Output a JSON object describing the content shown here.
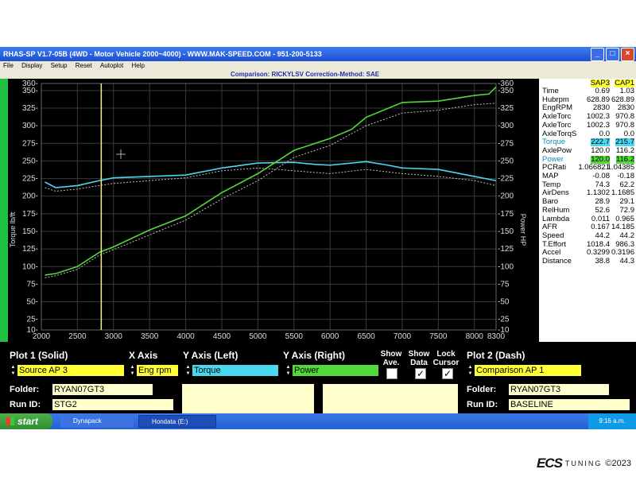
{
  "window": {
    "title": "RHAS-SP V1.7-05B  (4WD - Motor Vehicle 2000~4000) - WWW.MAK-SPEED.COM - 951-200-5133",
    "menu": [
      "File",
      "Display",
      "Setup",
      "Reset",
      "Autoplot",
      "Help"
    ],
    "comparison": "Comparison: RICKYLSV    Correction-Method: SAE"
  },
  "plot": {
    "y_left_label": "Torque lb/ft",
    "y_right_label": "Power HP",
    "cursor_rpm": 2830,
    "colors": {
      "solid_torque": "#4ad8f0",
      "solid_power": "#52d83a",
      "dash": "#c0c0c0",
      "cursor": "#f5f08a",
      "grid": "#3a3a3a"
    }
  },
  "chart_data": {
    "type": "line",
    "x_ticks": [
      2000,
      2500,
      3000,
      3500,
      4000,
      4500,
      5000,
      5500,
      6000,
      6500,
      7000,
      7500,
      8000,
      8300
    ],
    "y_ticks": [
      10,
      25,
      50,
      75,
      100,
      125,
      150,
      175,
      200,
      225,
      250,
      275,
      300,
      325,
      350,
      360
    ],
    "xlim": [
      2000,
      8300
    ],
    "ylim": [
      10,
      360
    ],
    "ylabel": "Torque lb/ft",
    "y2label": "Power HP",
    "series": [
      {
        "name": "Torque",
        "x": [
          2050,
          2200,
          2500,
          2800,
          3000,
          3500,
          4000,
          4500,
          5000,
          5500,
          5800,
          6000,
          6500,
          6800,
          7000,
          7500,
          8000,
          8300
        ],
        "values": [
          220,
          212,
          215,
          222,
          226,
          228,
          230,
          240,
          247,
          248,
          245,
          244,
          249,
          244,
          240,
          238,
          228,
          222
        ]
      },
      {
        "name": "Power",
        "x": [
          2050,
          2200,
          2500,
          2800,
          3000,
          3500,
          4000,
          4500,
          5000,
          5500,
          6000,
          6300,
          6500,
          7000,
          7500,
          8000,
          8200,
          8300
        ],
        "values": [
          88,
          90,
          100,
          120,
          128,
          152,
          172,
          205,
          232,
          265,
          282,
          295,
          312,
          333,
          335,
          343,
          345,
          355
        ]
      },
      {
        "x": [
          2050,
          2200,
          2500,
          2800,
          3000,
          3500,
          4000,
          4500,
          5000,
          5500,
          6000,
          6500,
          7000,
          7500,
          8000,
          8300
        ],
        "values": [
          212,
          207,
          210,
          215,
          218,
          222,
          226,
          236,
          240,
          236,
          232,
          238,
          232,
          228,
          222,
          215
        ]
      },
      {
        "x": [
          2050,
          2200,
          2500,
          2800,
          3000,
          3500,
          4000,
          4500,
          5000,
          5500,
          6000,
          6500,
          7000,
          7500,
          8000,
          8300
        ],
        "values": [
          84,
          87,
          96,
          116,
          124,
          145,
          166,
          196,
          222,
          255,
          272,
          300,
          318,
          322,
          330,
          332
        ]
      }
    ]
  },
  "readout": {
    "headers": [
      "SAP3",
      "CAP1"
    ],
    "rows": [
      {
        "label": "Time",
        "v1": "0.69",
        "v2": "1.03",
        "hl": ""
      },
      {
        "label": "Hubrpm",
        "v1": "628.89",
        "v2": "628.89",
        "hl": ""
      },
      {
        "label": "EngRPM",
        "v1": "2830",
        "v2": "2830",
        "hl": ""
      },
      {
        "label": "AxleTorc",
        "v1": "1002.3",
        "v2": "970.8",
        "hl": ""
      },
      {
        "label": "AxleTorc",
        "v1": "1002.3",
        "v2": "970.8",
        "hl": ""
      },
      {
        "label": "AxleTorqS",
        "v1": "0.0",
        "v2": "0.0",
        "hl": ""
      },
      {
        "label": "Torque",
        "v1": "222.7",
        "v2": "215.7",
        "hl": "#4ad8f0"
      },
      {
        "label": "AxlePow",
        "v1": "120.0",
        "v2": "116.2",
        "hl": ""
      },
      {
        "label": "Power",
        "v1": "120.0",
        "v2": "116.2",
        "hl": "#52d83a"
      },
      {
        "label": "PCRati",
        "v1": "1.066821",
        "v2": "1.04385",
        "hl": ""
      },
      {
        "label": "MAP",
        "v1": "-0.08",
        "v2": "-0.18",
        "hl": ""
      },
      {
        "label": "Temp",
        "v1": "74.3",
        "v2": "62.2",
        "hl": ""
      },
      {
        "label": "AirDens",
        "v1": "1.1302",
        "v2": "1.1685",
        "hl": ""
      },
      {
        "label": "Baro",
        "v1": "28.9",
        "v2": "29.1",
        "hl": ""
      },
      {
        "label": "RelHum",
        "v1": "52.6",
        "v2": "72.9",
        "hl": ""
      },
      {
        "label": "Lambda",
        "v1": "0.011",
        "v2": "0.965",
        "hl": ""
      },
      {
        "label": "AFR",
        "v1": "0.167",
        "v2": "14.185",
        "hl": ""
      },
      {
        "label": "Speed",
        "v1": "44.2",
        "v2": "44.2",
        "hl": ""
      },
      {
        "label": "T.Effort",
        "v1": "1018.4",
        "v2": "986.3",
        "hl": ""
      },
      {
        "label": "Accel",
        "v1": "0.3299",
        "v2": "0.3196",
        "hl": ""
      },
      {
        "label": "Distance",
        "v1": "38.8",
        "v2": "44.3",
        "hl": ""
      }
    ]
  },
  "controls": {
    "plot1_label": "Plot 1 (Solid)",
    "xaxis_label": "X Axis",
    "yleft_label": "Y Axis (Left)",
    "yright_label": "Y Axis (Right)",
    "show_ave_label": "Show Ave.",
    "show_data_label": "Show Data",
    "lock_cursor_label": "Lock Cursor",
    "plot2_label": "Plot 2 (Dash)",
    "plot1_source": "Source AP 3",
    "xaxis_value": "Eng rpm",
    "yleft_value": "Torque",
    "yright_value": "Power",
    "plot2_source": "Comparison AP 1",
    "folder_label": "Folder:",
    "runid_label": "Run ID:",
    "folder1": "RYAN07GT3",
    "runid1": "STG2",
    "folder2": "RYAN07GT3",
    "runid2": "BASELINE",
    "checkmark": "✓"
  },
  "taskbar": {
    "start": "start",
    "tasks": [
      "Dynapack",
      "Hondata (E:)"
    ],
    "clock": "9:16 a.m."
  },
  "watermark": {
    "brand": "ECS",
    "sub": "TUNING",
    "copyright": "©2023"
  }
}
